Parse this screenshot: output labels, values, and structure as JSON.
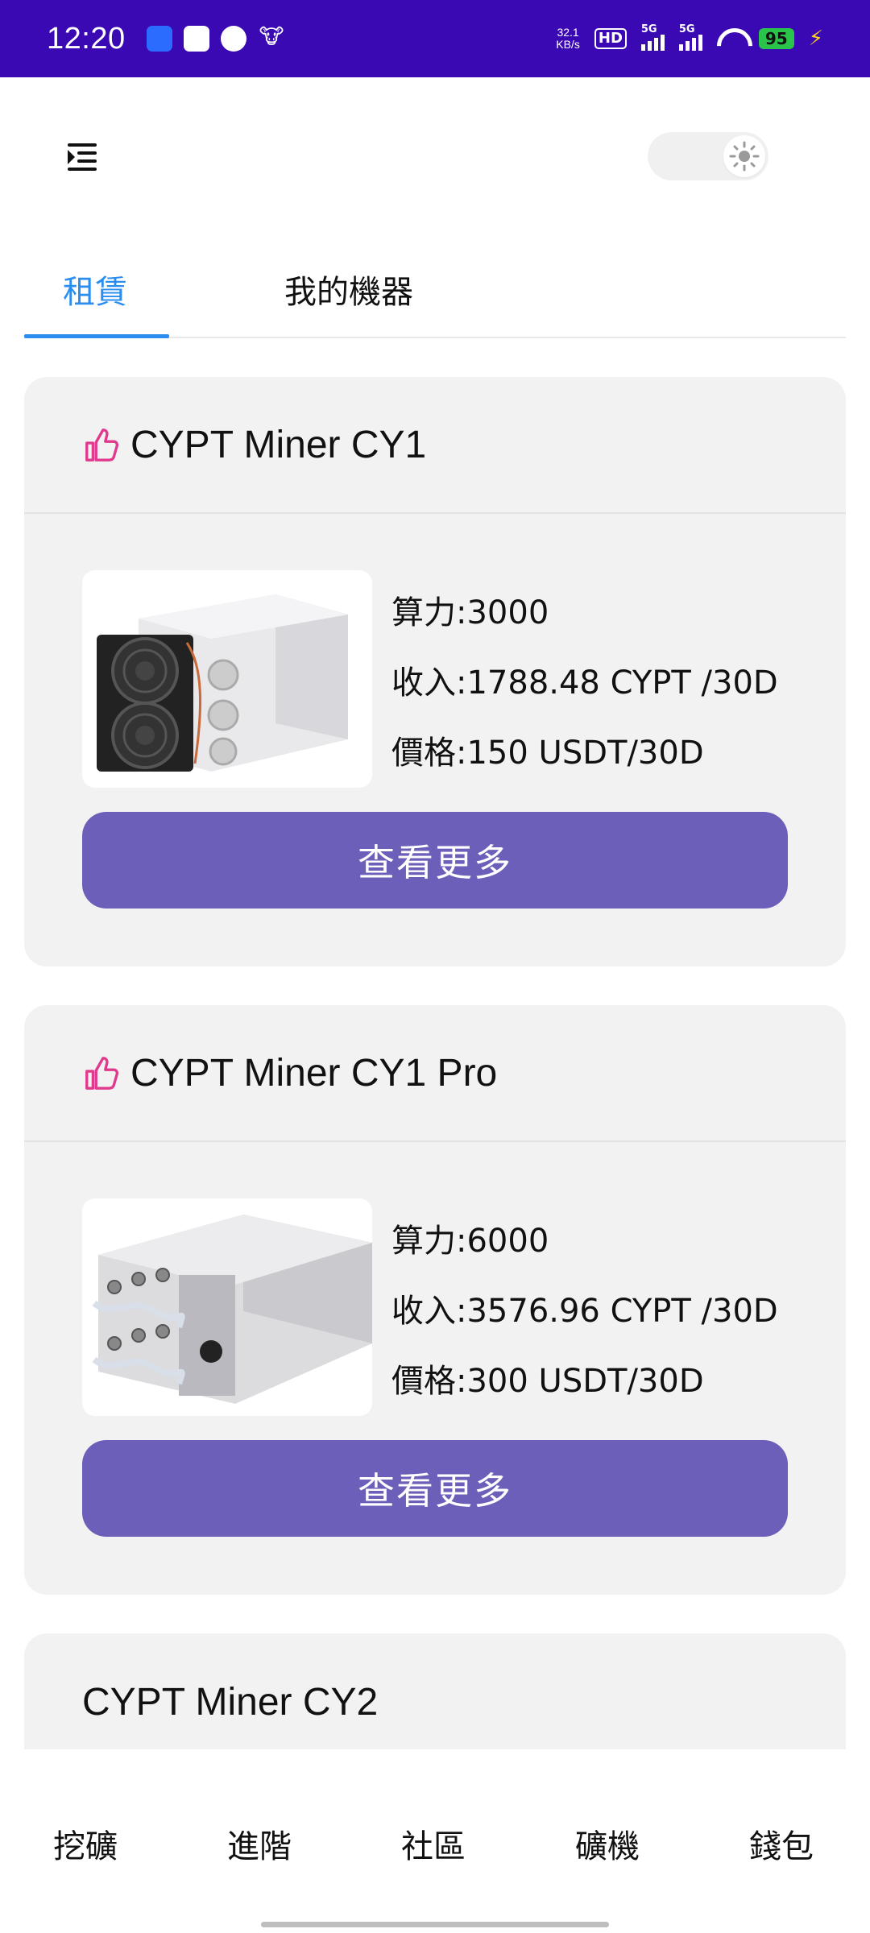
{
  "status_bar": {
    "time": "12:20",
    "net_speed": "32.1",
    "net_unit": "KB/s",
    "hd_label": "HD",
    "sim1_label": "5G",
    "sim2_label": "5G",
    "battery": "95",
    "icons": [
      "app-icon",
      "mail-icon",
      "check-icon",
      "cow-icon"
    ]
  },
  "header": {
    "menu_icon": "menu-indent-icon",
    "theme_icon": "sun-icon"
  },
  "tabs": [
    {
      "label": "租賃",
      "active": true
    },
    {
      "label": "我的機器",
      "active": false
    }
  ],
  "cards": [
    {
      "title": "CYPT Miner CY1",
      "icon": "thumbs-up-icon",
      "hashrate": "算力:3000",
      "income": "收入:1788.48 CYPT /30D",
      "price": "價格:150 USDT/30D",
      "button": "查看更多"
    },
    {
      "title": "CYPT Miner CY1 Pro",
      "icon": "thumbs-up-icon",
      "hashrate": "算力:6000",
      "income": "收入:3576.96 CYPT /30D",
      "price": "價格:300 USDT/30D",
      "button": "查看更多"
    },
    {
      "title": "CYPT Miner CY2"
    }
  ],
  "bottom_nav": [
    {
      "label": "挖礦"
    },
    {
      "label": "進階"
    },
    {
      "label": "社區"
    },
    {
      "label": "礦機"
    },
    {
      "label": "錢包"
    }
  ],
  "colors": {
    "status_bar": "#3a09b3",
    "accent_tab": "#2a8ef0",
    "button": "#6c5fba",
    "thumb_icon": "#e03a8c",
    "card_bg": "#f2f2f3"
  }
}
